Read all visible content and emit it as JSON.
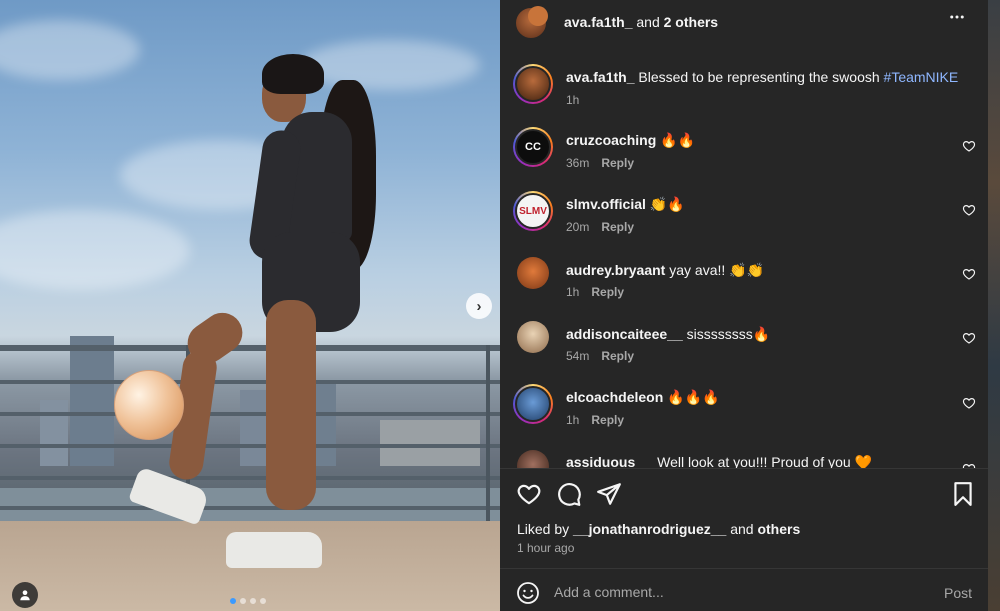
{
  "header": {
    "username": "ava.fa1th_",
    "and_text": "and",
    "others": "2 others"
  },
  "caption": {
    "username": "ava.fa1th_",
    "text": "Blessed to be representing the swoosh",
    "hashtag": "#TeamNIKE",
    "time": "1h"
  },
  "comments": [
    {
      "username": "cruzcoaching",
      "text": "🔥🔥",
      "time": "36m",
      "reply": "Reply"
    },
    {
      "username": "slmv.official",
      "text": "👏🔥",
      "time": "20m",
      "reply": "Reply"
    },
    {
      "username": "audrey.bryaant",
      "text": "yay ava!! 👏👏",
      "time": "1h",
      "reply": "Reply"
    },
    {
      "username": "addisoncaiteee__",
      "text": "sissssssss🔥",
      "time": "54m",
      "reply": "Reply"
    },
    {
      "username": "elcoachdeleon",
      "text": "🔥🔥🔥",
      "time": "1h",
      "reply": "Reply"
    },
    {
      "username": "assiduous",
      "text": "Well look at you!!! Proud of you 🧡"
    }
  ],
  "likes": {
    "prefix": "Liked by",
    "user": "__jonathanrodriguez__",
    "and_text": "and",
    "others": "others",
    "time_ago": "1 hour ago"
  },
  "add_comment": {
    "placeholder": "Add a comment...",
    "post_label": "Post"
  },
  "media": {
    "current_slide": 1,
    "total_slides": 4
  },
  "colors": {
    "panel_bg": "#262626",
    "text": "#f5f5f5",
    "muted": "#a8a8a8",
    "hashtag": "#8fb7ff",
    "active_dot": "#3b9aff"
  },
  "icons": [
    "more-icon",
    "chevron-right-icon",
    "user-tag-icon",
    "heart-icon",
    "comment-icon",
    "share-icon",
    "bookmark-icon",
    "emoji-icon"
  ]
}
